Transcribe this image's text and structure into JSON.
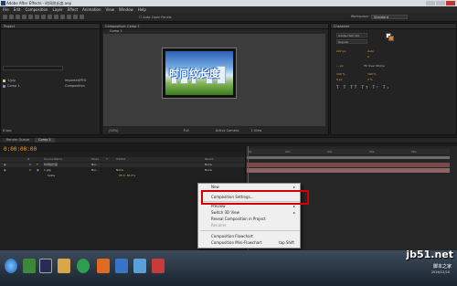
{
  "window": {
    "title": "Adobe After Effects - 时间纹长度.aep"
  },
  "menu": [
    "File",
    "Edit",
    "Composition",
    "Layer",
    "Effect",
    "Animation",
    "View",
    "Window",
    "Help"
  ],
  "toolbar": {
    "auto_open_panels": "Auto-Open Panels",
    "workspace_label": "Workspace:",
    "workspace_value": "Standard"
  },
  "project_panel": {
    "tab": "Project",
    "items": [
      {
        "name": "1.jpg",
        "type": "ImporterJPEG",
        "color": "#d7c86e"
      },
      {
        "name": "Comp 1",
        "type": "Composition",
        "color": "#7d8fc2"
      }
    ],
    "footer_bpc": "8 bpc"
  },
  "comp_panel": {
    "tab": "Composition: Comp 1",
    "subtab": "Comp 1",
    "image_text": "时间纹长度",
    "zoom": "(50%)",
    "resolution": "Full",
    "camera": "Active Camera",
    "views": "1 View"
  },
  "character_panel": {
    "tab": "Character",
    "font": "Adobe Heiti Std",
    "style": "Regular",
    "size": "222 px",
    "leading": "Auto",
    "tracking": "0",
    "stroke": "Fill Over Stroke",
    "scale_v": "100 %",
    "scale_h": "100 %",
    "baseline": "0 px",
    "tsume": "0 %"
  },
  "timeline": {
    "tabs": [
      "Render Queue",
      "Comp 1"
    ],
    "timecode": "0:00:00:00",
    "columns": [
      "#",
      "Source Name",
      "Mode",
      "T",
      "TrkMat",
      "Parent"
    ],
    "layers": [
      {
        "num": "1",
        "name": "时间纹长度",
        "mode": "Nor...",
        "trkmat": "",
        "parent": "None"
      },
      {
        "num": "2",
        "name": "1.jpg",
        "mode": "Nor...",
        "trkmat": "None",
        "parent": "None"
      }
    ],
    "scale_label": "Scale",
    "scale_value": "85.6, 85.6%",
    "ruler_marks": [
      "0s",
      "02s",
      "04s",
      "06s",
      "08s"
    ]
  },
  "context_menu": {
    "items": [
      {
        "label": "New",
        "submenu": true,
        "disabled": false
      },
      {
        "label": "Composition Settings...",
        "submenu": false,
        "disabled": false
      },
      {
        "label": "Preview",
        "submenu": true,
        "disabled": false
      },
      {
        "label": "Switch 3D View",
        "submenu": true,
        "disabled": false
      },
      {
        "label": "Reveal Composition in Project",
        "submenu": false,
        "disabled": false
      },
      {
        "label": "Rename",
        "submenu": false,
        "disabled": true
      },
      {
        "label": "Composition Flowchart",
        "submenu": false,
        "disabled": false
      },
      {
        "label": "Composition Mini-Flowchart",
        "submenu": false,
        "disabled": false,
        "shortcut": "tap Shift"
      }
    ]
  },
  "taskbar": {
    "date": "2016/12/20"
  },
  "watermark": {
    "line1": "jb51.net",
    "line2": "脚本之家"
  },
  "colors": {
    "highlight": "#d40000",
    "timecode": "#f0a020",
    "playhead": "#dd2233"
  }
}
